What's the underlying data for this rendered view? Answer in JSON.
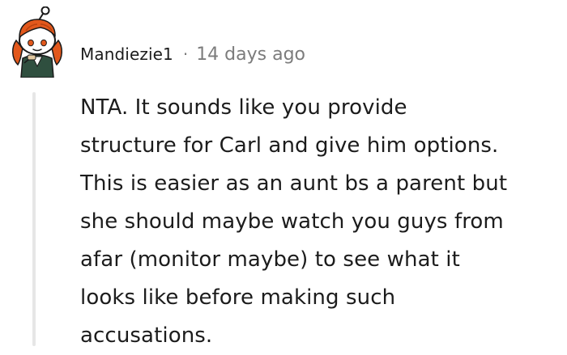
{
  "comment": {
    "username": "Mandiezie1",
    "separator": "·",
    "timestamp": "14 days ago",
    "avatar_icon": "snoo-avatar-icon",
    "body_lines": [
      "NTA. It sounds like you provide",
      "structure for Carl and give him options.",
      "This is easier as an aunt bs a parent but",
      "she should maybe watch you guys from",
      "afar (monitor maybe) to see what it",
      "looks like before making such",
      "accusations."
    ]
  },
  "colors": {
    "text": "#1c1c1c",
    "meta": "#7c7c7c",
    "thread_line": "#e6e6e6",
    "avatar_hair": "#e2581c",
    "avatar_body": "#2f4f3f"
  }
}
